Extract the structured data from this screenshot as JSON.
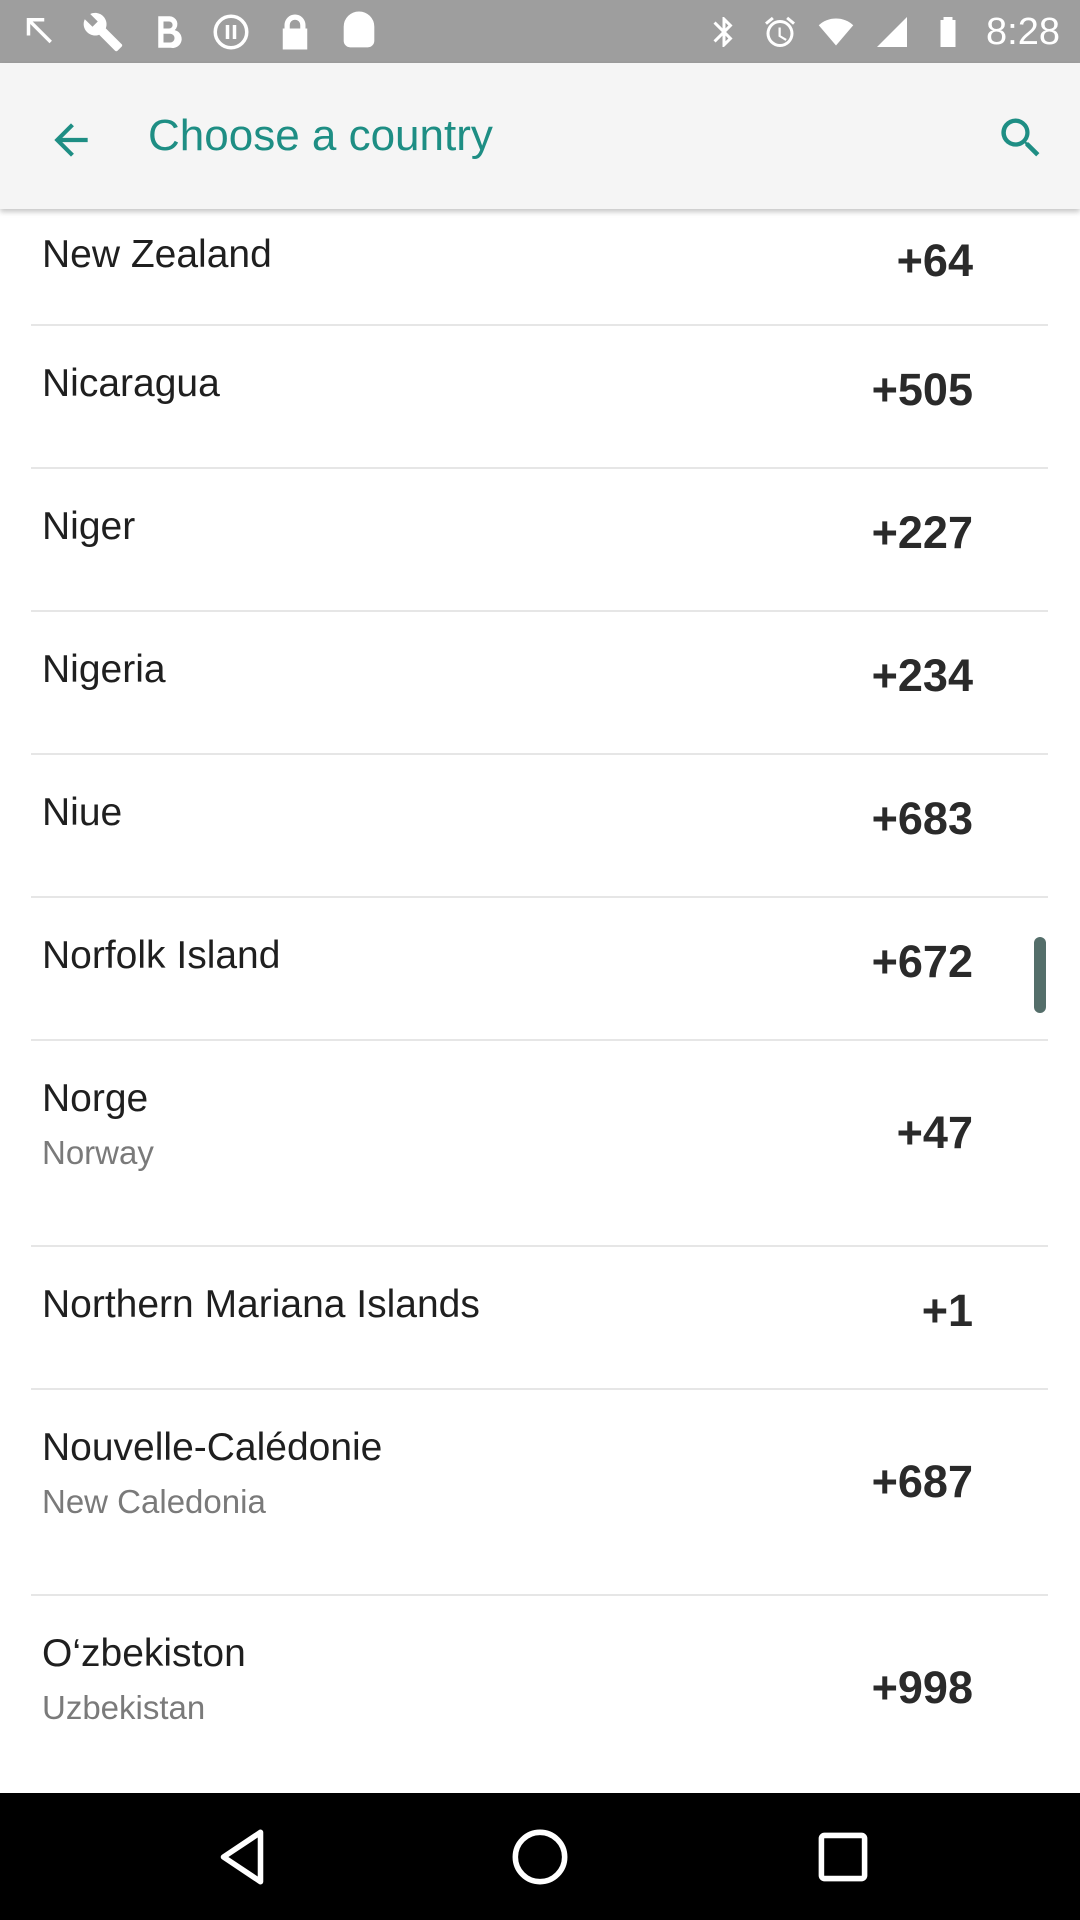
{
  "status_bar": {
    "time": "8:28",
    "left_icons": [
      "notification-arrow-icon",
      "wrench-icon",
      "bold-b-icon",
      "media-icon",
      "lock-icon",
      "android-icon"
    ],
    "right_icons": [
      "bluetooth-icon",
      "alarm-icon",
      "wifi-icon",
      "signal-icon",
      "battery-icon"
    ]
  },
  "app_bar": {
    "title": "Choose a country",
    "back_icon": "arrow-back-icon",
    "search_icon": "search-icon"
  },
  "colors": {
    "accent": "#1e8e84",
    "status_bar": "#9e9e9e",
    "app_bar": "#f5f5f5",
    "divider": "#e6e6e6",
    "nav_bar": "#000000"
  },
  "countries": [
    {
      "name": "New Zealand",
      "code": "+64"
    },
    {
      "name": "Nicaragua",
      "code": "+505"
    },
    {
      "name": "Niger",
      "code": "+227"
    },
    {
      "name": "Nigeria",
      "code": "+234"
    },
    {
      "name": "Niue",
      "code": "+683"
    },
    {
      "name": "Norfolk Island",
      "code": "+672"
    },
    {
      "name": "Norge",
      "subtitle": "Norway",
      "code": "+47"
    },
    {
      "name": "Northern Mariana Islands",
      "code": "+1"
    },
    {
      "name": "Nouvelle-Calédonie",
      "subtitle": "New Caledonia",
      "code": "+687"
    },
    {
      "name": "O‘zbekiston",
      "subtitle": "Uzbekistan",
      "code": "+998"
    }
  ],
  "nav_bar": {
    "icons": [
      "nav-back-icon",
      "nav-home-icon",
      "nav-recents-icon"
    ]
  }
}
